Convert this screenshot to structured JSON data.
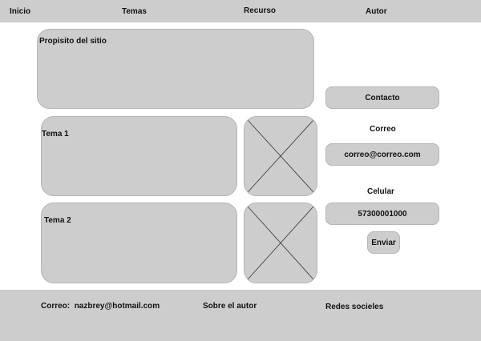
{
  "nav": {
    "home": "Inicio",
    "topics": "Temas",
    "resource": "Recurso",
    "author": "Autor"
  },
  "main": {
    "purpose_label": "Propisito del sitio",
    "topic1_label": "Tema 1",
    "topic2_label": "Tema 2"
  },
  "contact": {
    "header": "Contacto",
    "email_label": "Correo",
    "email_value": "correo@correo.com",
    "phone_label": "Celular",
    "phone_value": "57300001000",
    "send_button": "Enviar"
  },
  "footer": {
    "email_label": "Correo:",
    "email_value": "nazbrey@hotmail.com",
    "about_author": "Sobre el autor",
    "social": "Redes socieles"
  },
  "colors": {
    "panel": "#cdcdcd",
    "background": "#ffffff",
    "text": "#111111"
  }
}
